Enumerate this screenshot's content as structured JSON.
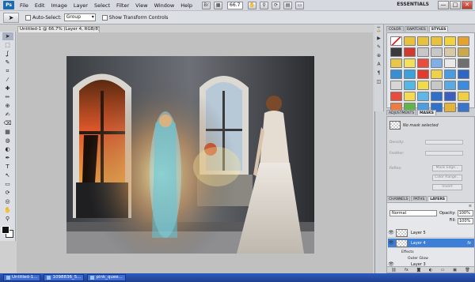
{
  "menubar": {
    "logo": "Ps",
    "items": [
      "File",
      "Edit",
      "Image",
      "Layer",
      "Select",
      "Filter",
      "View",
      "Window",
      "Help"
    ],
    "zoom": "66.7",
    "workspace": "ESSENTIALS",
    "window_controls": [
      "—",
      "□",
      "✕"
    ]
  },
  "options": {
    "auto_select_label": "Auto-Select:",
    "auto_select_value": "Group",
    "transform_label": "Show Transform Controls"
  },
  "document": {
    "tab_title": "Untitled-1 @ 66.7% (Layer 4, RGB/8) *"
  },
  "tools": [
    "move-tool",
    "marquee-tool",
    "lasso-tool",
    "quick-select-tool",
    "crop-tool",
    "eyedropper-tool",
    "healing-tool",
    "brush-tool",
    "clone-stamp-tool",
    "history-brush-tool",
    "eraser-tool",
    "gradient-tool",
    "blur-tool",
    "dodge-tool",
    "pen-tool",
    "type-tool",
    "path-select-tool",
    "shape-tool",
    "3d-rotate-tool",
    "3d-orbit-tool",
    "hand-tool",
    "zoom-tool"
  ],
  "tool_glyphs": [
    "➤",
    "⬚",
    "ʆ",
    "✎",
    "⌗",
    "⁄",
    "✚",
    "✏",
    "⊕",
    "✍",
    "⌫",
    "▦",
    "◍",
    "◐",
    "✒",
    "T",
    "↖",
    "▭",
    "⟳",
    "◎",
    "✋",
    "⚲"
  ],
  "panels": {
    "top_tabs": [
      "COLOR",
      "SWATCHES",
      "STYLES"
    ],
    "adj_tabs": [
      "ADJUSTMENTS",
      "MASKS"
    ],
    "mask_status": "No mask selected",
    "adj_rows": {
      "density": "Density:",
      "feather": "Feather:",
      "refine": "Refine:"
    },
    "adj_buttons": {
      "mask_edge": "Mask Edge...",
      "color_range": "Color Range...",
      "invert": "Invert"
    },
    "layer_tabs": [
      "CHANNELS",
      "PATHS",
      "LAYERS"
    ],
    "blend_mode": "Normal",
    "opacity_label": "Opacity:",
    "opacity": "100%",
    "fill_label": "Fill:",
    "fill": "100%",
    "layers": [
      "Layer 5",
      "Layer 4",
      "Layer 3"
    ],
    "effects_label": "Effects",
    "outer_glow_label": "Outer Glow",
    "fx_badge": "fx"
  },
  "styles_colors": [
    "#ffffff",
    "#e8c23b",
    "#e8c23b",
    "#e8c23b",
    "#f0d33d",
    "#e6a22d",
    "#3b3b3b",
    "#d13a2c",
    "#c7c7c7",
    "#c7c7c7",
    "#d6c9a5",
    "#caa94c",
    "#e7c64a",
    "#f3e05c",
    "#e94b3c",
    "#7fb0e5",
    "#e9e9e9",
    "#6f6f6f",
    "#3a8fd4",
    "#3ca0dc",
    "#e23b2d",
    "#eed14a",
    "#4a9be0",
    "#2e66c3",
    "#d6d6d6",
    "#54b8e6",
    "#f2da4d",
    "#c7c7c7",
    "#5aa9e2",
    "#3c8cdd",
    "#e74c3c",
    "#f3da50",
    "#60b6e8",
    "#2f6ec9",
    "#3b5fbf",
    "#f0cf45",
    "#f07b42",
    "#5fb54a",
    "#4b9fe0",
    "#2f71cb",
    "#e4b43a",
    "#3c74cc"
  ],
  "taskbar": [
    "Untitled-1...",
    "1098836_5...",
    "pink_quee..."
  ]
}
